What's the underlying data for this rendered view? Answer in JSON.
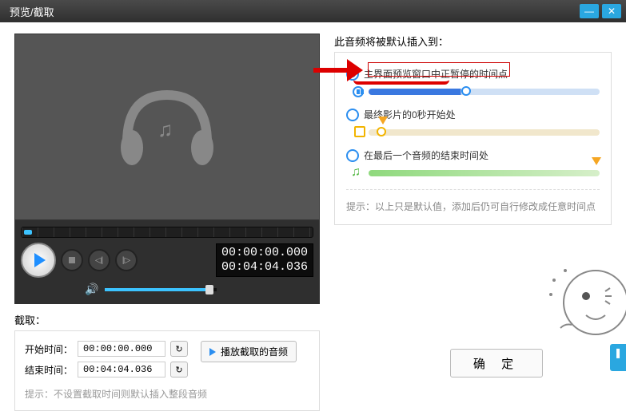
{
  "window": {
    "title": "预览/截取"
  },
  "player": {
    "time_current": "00:00:00.000",
    "time_total": "00:04:04.036"
  },
  "insert": {
    "heading": "此音频将被默认插入到：",
    "opt1": "主界面预览窗口中正暂停的时间点",
    "opt2": "最终影片的0秒开始处",
    "opt3": "在最后一个音频的结束时间处",
    "hint_prefix": "提示：",
    "hint_text": "以上只是默认值，添加后仍可自行修改成任意时间点"
  },
  "cut": {
    "heading": "截取：",
    "start_label": "开始时间：",
    "end_label": "结束时间：",
    "start_value": "00:00:00.000",
    "end_value": "00:04:04.036",
    "play_label": "播放截取的音频",
    "hint_prefix": "提示：",
    "hint_text": "不设置截取时间则默认插入整段音频"
  },
  "footer": {
    "ok": "确 定"
  }
}
